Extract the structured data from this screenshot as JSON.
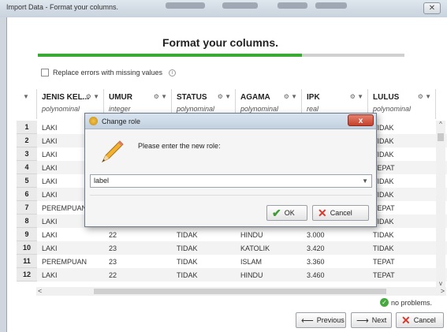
{
  "window": {
    "title": "Import Data - Format your columns.",
    "close_glyph": "✕"
  },
  "heading": "Format your columns.",
  "progress": {
    "fraction": 0.72,
    "color": "#3aaa35"
  },
  "replace_errors": {
    "label": "Replace errors with missing values",
    "checked": false
  },
  "columns": [
    {
      "name": "JENIS KEL...",
      "type": "polynominal"
    },
    {
      "name": "UMUR",
      "type": "integer"
    },
    {
      "name": "STATUS",
      "type": "polynominal"
    },
    {
      "name": "AGAMA",
      "type": "polynominal"
    },
    {
      "name": "IPK",
      "type": "real"
    },
    {
      "name": "LULUS",
      "type": "polynominal"
    }
  ],
  "rows": [
    {
      "num": "1",
      "cells": [
        "LAKI",
        "",
        "",
        "",
        "",
        "TIDAK"
      ]
    },
    {
      "num": "2",
      "cells": [
        "LAKI",
        "",
        "",
        "",
        "",
        "TIDAK"
      ]
    },
    {
      "num": "3",
      "cells": [
        "LAKI",
        "",
        "",
        "",
        "",
        "TIDAK"
      ]
    },
    {
      "num": "4",
      "cells": [
        "LAKI",
        "",
        "",
        "",
        "",
        "TEPAT"
      ]
    },
    {
      "num": "5",
      "cells": [
        "LAKI",
        "",
        "",
        "",
        "",
        "TIDAK"
      ]
    },
    {
      "num": "6",
      "cells": [
        "LAKI",
        "",
        "",
        "",
        "",
        "TIDAK"
      ]
    },
    {
      "num": "7",
      "cells": [
        "PEREMPUAN",
        "",
        "",
        "",
        "",
        "TEPAT"
      ]
    },
    {
      "num": "8",
      "cells": [
        "LAKI",
        "",
        "",
        "",
        "",
        "TIDAK"
      ]
    },
    {
      "num": "9",
      "cells": [
        "LAKI",
        "22",
        "TIDAK",
        "HINDU",
        "3.000",
        "TIDAK"
      ]
    },
    {
      "num": "10",
      "cells": [
        "LAKI",
        "23",
        "TIDAK",
        "KATOLIK",
        "3.420",
        "TIDAK"
      ]
    },
    {
      "num": "11",
      "cells": [
        "PEREMPUAN",
        "23",
        "TIDAK",
        "ISLAM",
        "3.360",
        "TEPAT"
      ]
    },
    {
      "num": "12",
      "cells": [
        "LAKI",
        "22",
        "TIDAK",
        "HINDU",
        "3.460",
        "TEPAT"
      ]
    }
  ],
  "status": {
    "text": "no problems."
  },
  "nav": {
    "previous": "Previous",
    "next": "Next",
    "cancel": "Cancel"
  },
  "dialog": {
    "title": "Change role",
    "prompt": "Please enter the new role:",
    "value": "label",
    "ok": "OK",
    "cancel": "Cancel",
    "close_glyph": "x"
  },
  "icons": {
    "column_menu": "gear-icon",
    "dropdown": "chevron-down-icon",
    "pencil": "pencil-icon",
    "ok": "check-icon",
    "cancel": "x-icon"
  }
}
